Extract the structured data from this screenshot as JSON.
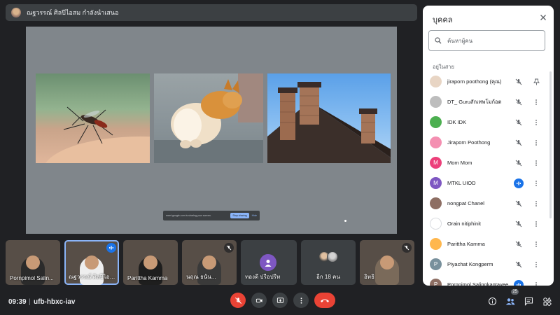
{
  "presenter": {
    "text": "ณฐวรรณ์ ศิลปีไอสม กำลังนำเสนอ"
  },
  "share_bar": {
    "text": "meet.google.com is sharing your screen.",
    "stop_label": "Stop sharing",
    "hide_label": "Hide"
  },
  "tiles": [
    {
      "name": "Pornpimol Salin..."
    },
    {
      "name": "ณฐวรรณ์ ศิลปีไอสม"
    },
    {
      "name": "Parittha Kamma"
    },
    {
      "name": "นฤณ ธนัน..."
    },
    {
      "name": "ทองดี ปรีอปรีท",
      "initial": ""
    },
    {
      "name": "อีก 18 คน"
    },
    {
      "name": "อิทธิ"
    }
  ],
  "bottom": {
    "time": "09:39",
    "separator": "|",
    "code": "ufb-hbxc-iav",
    "people_count": "25"
  },
  "panel": {
    "title": "บุคคล",
    "search_placeholder": "ค้นหาผู้คน",
    "section": "อยู่ในสาย",
    "people": [
      {
        "name": "jiraporn poothong (คุณ)",
        "avatar_color": "#e8d5c4",
        "initial": ""
      },
      {
        "name": "DT_ Guruสักเทพโมก้อต",
        "avatar_color": "#bdbdbd",
        "initial": ""
      },
      {
        "name": "IDK IDK",
        "avatar_color": "#4caf50",
        "initial": ""
      },
      {
        "name": "Jiraporn Poothong",
        "avatar_color": "#f48fb1",
        "initial": ""
      },
      {
        "name": "Mom Mom",
        "avatar_color": "#ec407a",
        "initial": "M"
      },
      {
        "name": "MTKL UIOD",
        "avatar_color": "#7e57c2",
        "initial": "M"
      },
      {
        "name": "nongpat Chanel",
        "avatar_color": "#8d6e63",
        "initial": ""
      },
      {
        "name": "Orain nitiphinit",
        "avatar_color": "#ffffff",
        "initial": ""
      },
      {
        "name": "Parittha Kamma",
        "avatar_color": "#ffb74d",
        "initial": ""
      },
      {
        "name": "Piyachat Kongperm",
        "avatar_color": "#78909c",
        "initial": "P"
      },
      {
        "name": "Pornpimol Salingkantavee...",
        "avatar_color": "#8d6e63",
        "initial": "P"
      }
    ]
  }
}
